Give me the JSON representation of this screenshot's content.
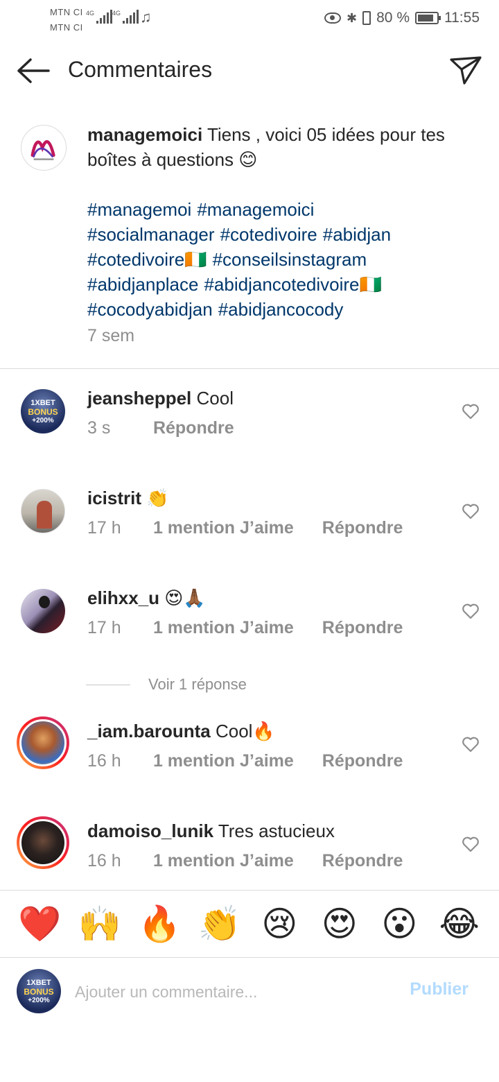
{
  "status_bar": {
    "carrier_1": "MTN CI",
    "carrier_2": "MTN CI",
    "network_1": "4G",
    "network_2": "4G",
    "battery": "80 %",
    "time": "11:55"
  },
  "header": {
    "title": "Commentaires"
  },
  "caption": {
    "username": "managemoici",
    "text": "Tiens , voici 05 idées pour tes boîtes à questions 😊",
    "hashtags": [
      "#managemoi",
      "#managemoici",
      "#socialmanager",
      "#cotedivoire",
      "#abidjan",
      "#cotedivoire🇨🇮",
      "#conseilsinstagram",
      "#abidjanplace",
      "#abidjancotedivoire🇨🇮",
      "#cocodyabidjan",
      "#abidjancocody"
    ],
    "time": "7 sem"
  },
  "comments": [
    {
      "username": "jeansheppel",
      "text": "Cool",
      "time": "3 s",
      "likes": "",
      "reply": "Répondre"
    },
    {
      "username": "icistrit",
      "text": "👏",
      "time": "17 h",
      "likes": "1 mention J’aime",
      "reply": "Répondre"
    },
    {
      "username": "elihxx_u",
      "text": "😍🙏🏾",
      "time": "17 h",
      "likes": "1 mention J’aime",
      "reply": "Répondre"
    },
    {
      "username": "_iam.barounta",
      "text": "Cool🔥",
      "time": "16 h",
      "likes": "1 mention J’aime",
      "reply": "Répondre"
    },
    {
      "username": "damoiso_lunik",
      "text": "Tres astucieux",
      "time": "16 h",
      "likes": "1 mention J’aime",
      "reply": "Répondre"
    }
  ],
  "view_replies": "Voir 1 réponse",
  "emoji_bar": [
    "❤️",
    "🙌",
    "🔥",
    "👏",
    "😢",
    "😍",
    "😮",
    "😂"
  ],
  "input": {
    "placeholder": "Ajouter un commentaire...",
    "value": "",
    "publish_label": "Publier"
  },
  "colors": {
    "hashtag": "#00376b",
    "secondary_text": "#8e8e8e",
    "publish_disabled": "#b3dbff",
    "heart_icon": "#8e8e8e"
  }
}
